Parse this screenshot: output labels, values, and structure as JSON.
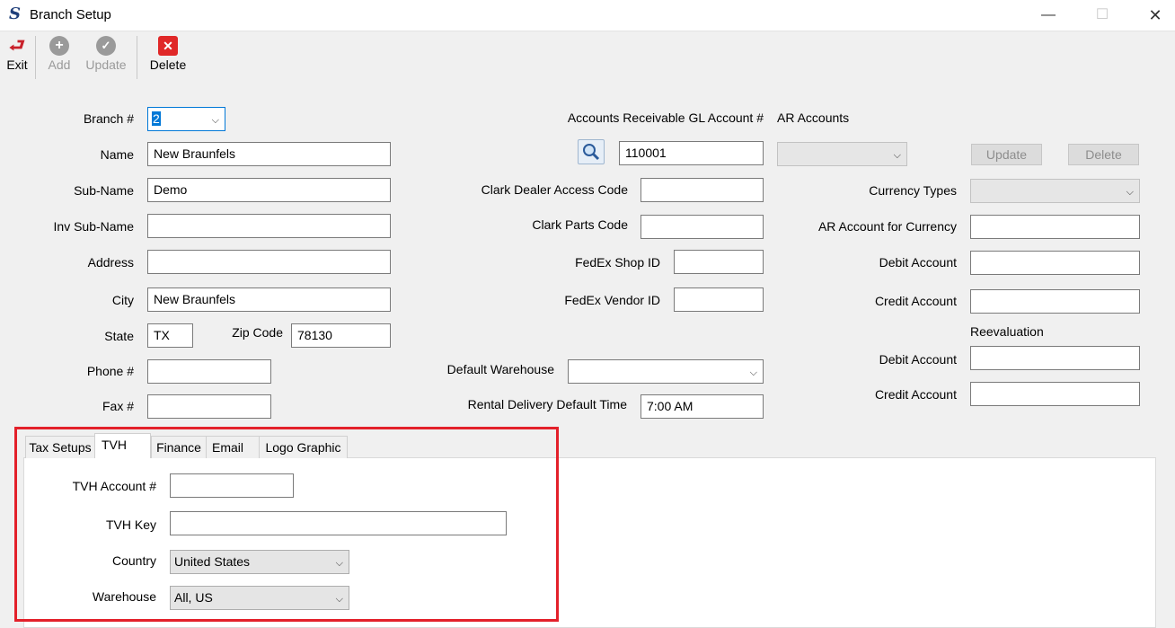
{
  "window": {
    "title": "Branch Setup",
    "minimize": "—",
    "maximize": "☐",
    "close": "✕"
  },
  "toolbar": {
    "exit": "Exit",
    "add": "Add",
    "update": "Update",
    "delete": "Delete"
  },
  "left": {
    "branch_label": "Branch #",
    "branch_value": "2",
    "name_label": "Name",
    "name_value": "New Braunfels",
    "subname_label": "Sub-Name",
    "subname_value": "Demo",
    "invsub_label": "Inv Sub-Name",
    "invsub_value": "",
    "address_label": "Address",
    "address_value": "",
    "city_label": "City",
    "city_value": "New Braunfels",
    "state_label": "State",
    "state_value": "TX",
    "zip_label": "Zip Code",
    "zip_value": "78130",
    "phone_label": "Phone #",
    "phone_value": "",
    "fax_label": "Fax #",
    "fax_value": ""
  },
  "middle": {
    "ar_gl_label": "Accounts Receivable GL Account #",
    "ar_gl_value": "110001",
    "clark_dealer_label": "Clark Dealer Access Code",
    "clark_dealer_value": "",
    "clark_parts_label": "Clark Parts Code",
    "clark_parts_value": "",
    "fedex_shop_label": "FedEx Shop ID",
    "fedex_shop_value": "",
    "fedex_vendor_label": "FedEx Vendor ID",
    "fedex_vendor_value": "",
    "default_wh_label": "Default Warehouse",
    "default_wh_value": "",
    "rental_time_label": "Rental Delivery Default Time",
    "rental_time_value": "7:00 AM"
  },
  "right": {
    "ar_accounts_label": "AR Accounts",
    "ar_accounts_value": "",
    "update_btn": "Update",
    "delete_btn": "Delete",
    "currency_types_label": "Currency Types",
    "currency_types_value": "",
    "ar_currency_label": "AR Account for Currency",
    "ar_currency_value": "",
    "debit_label": "Debit Account",
    "debit_value": "",
    "credit_label": "Credit Account",
    "credit_value": "",
    "reevaluation_label": "Reevaluation",
    "re_debit_label": "Debit Account",
    "re_debit_value": "",
    "re_credit_label": "Credit Account",
    "re_credit_value": ""
  },
  "tabs": {
    "items": [
      "Tax Setups",
      "TVH",
      "Finance",
      "Email",
      "Logo Graphic"
    ],
    "active": "TVH"
  },
  "tvh": {
    "account_label": "TVH Account #",
    "account_value": "",
    "key_label": "TVH Key",
    "key_value": "",
    "country_label": "Country",
    "country_value": "United States",
    "warehouse_label": "Warehouse",
    "warehouse_value": "All, US"
  },
  "colors": {
    "highlight": "#e3202a",
    "exit": "#c8202a",
    "delete": "#e02828",
    "disabled": "#9a9a9a"
  }
}
